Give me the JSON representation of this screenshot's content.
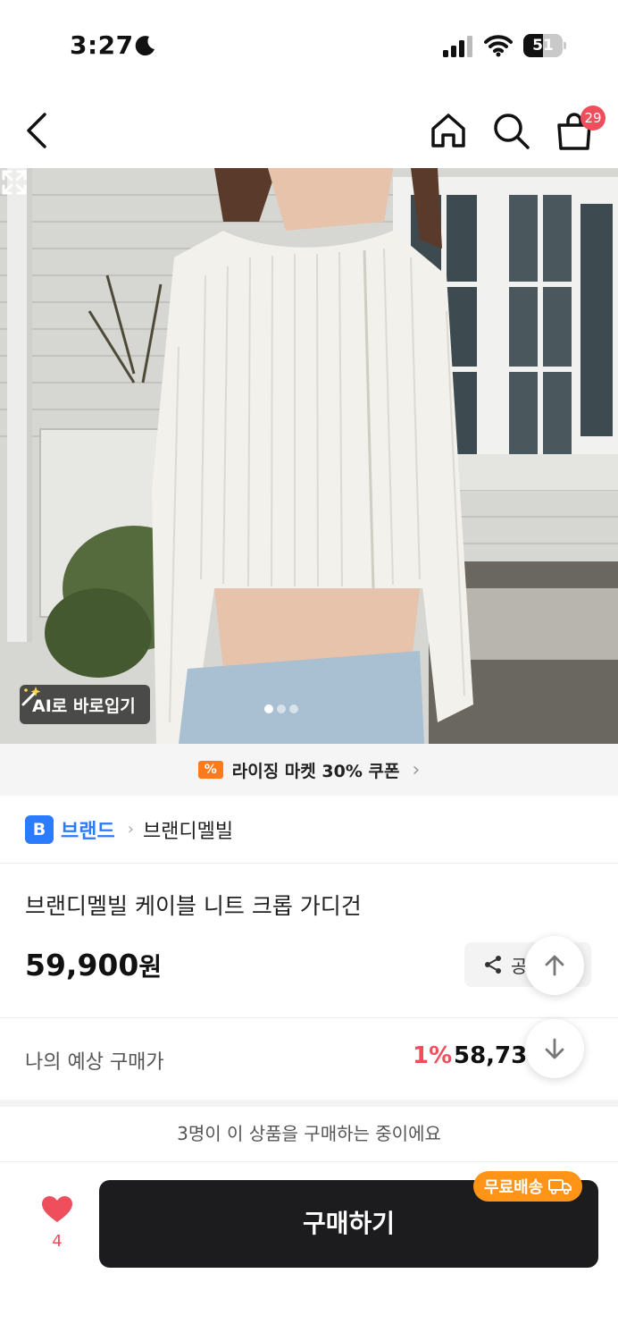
{
  "status_bar": {
    "time": "3:27",
    "battery_level": "51",
    "battery_fraction": 0.51
  },
  "nav": {
    "cart_count": "29",
    "icons": [
      "back-icon",
      "home-icon",
      "search-icon",
      "bag-icon"
    ]
  },
  "hero": {
    "ai_tryon_label": "AI로 바로입기",
    "carousel": {
      "count": 3,
      "active_index": 0
    }
  },
  "coupon_banner": {
    "icon_text": "%",
    "text": "라이징 마켓 30% 쿠폰"
  },
  "brand": {
    "badge": "B",
    "category": "브랜드",
    "name": "브랜디멜빌"
  },
  "product": {
    "title": "브랜디멜빌 케이블 니트 크롭 가디건",
    "price": "59,900",
    "price_unit": "원",
    "share_label": "공유"
  },
  "expected": {
    "label": "나의 예상 구매가",
    "rate": "1%",
    "price": "58,730"
  },
  "footer": {
    "buying_notice": "3명이 이 상품을 구매하는 중이에요",
    "like_count": "4",
    "buy_label": "구매하기",
    "free_shipping": "무료배송"
  },
  "colors": {
    "accent_red": "#ef4e5c",
    "brand_blue": "#2b7bff",
    "shipping_orange": "#ff9416",
    "buy_button": "#1c1c1e"
  }
}
